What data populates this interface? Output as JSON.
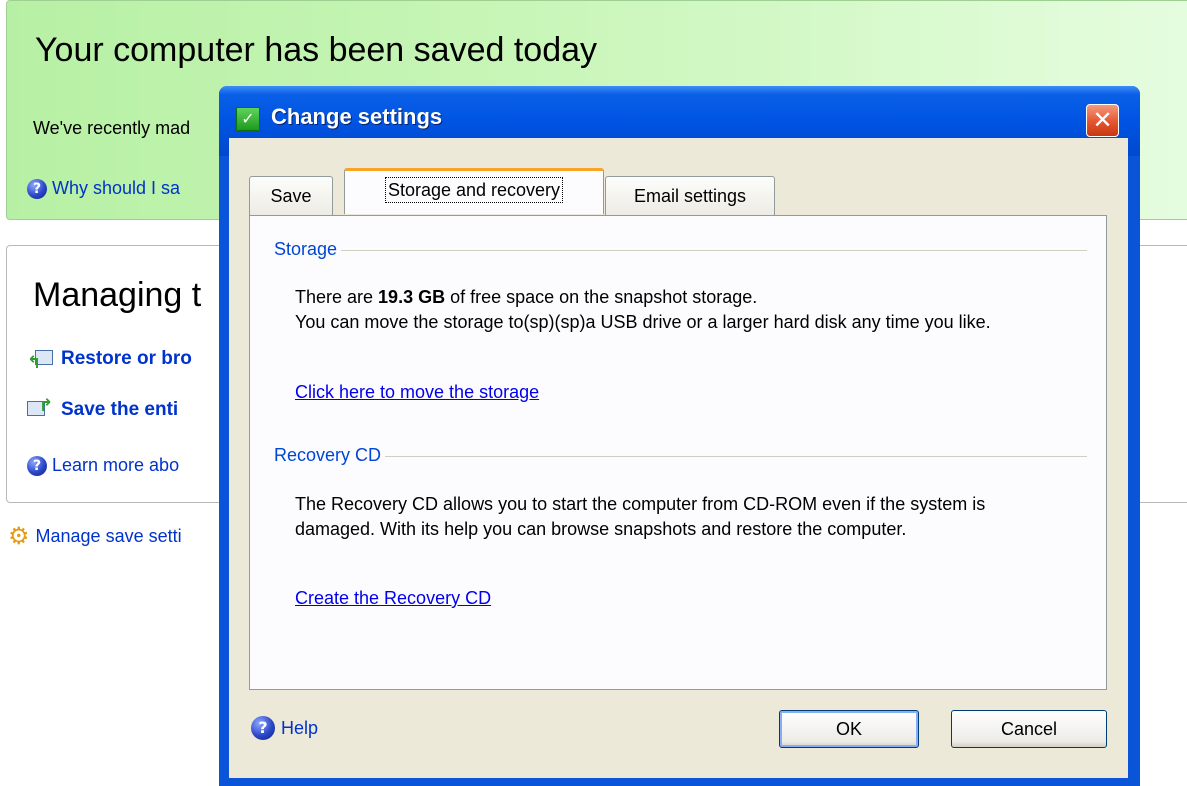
{
  "background": {
    "status_title": "Your computer has been saved today",
    "status_desc": "We've recently mad",
    "why_link": "Why should I sa",
    "manage_title": "Managing t",
    "restore_link": "Restore or bro",
    "save_entire_link": "Save the enti",
    "learn_more_link": "Learn more abo",
    "manage_settings_link": "Manage save setti"
  },
  "dialog": {
    "title": "Change settings",
    "close_glyph": "✕",
    "tabs": [
      {
        "label": "Save",
        "active": false
      },
      {
        "label": "Storage and recovery",
        "active": true
      },
      {
        "label": "Email settings",
        "active": false
      }
    ],
    "storage": {
      "heading": "Storage",
      "line1_prefix": "There are ",
      "free_space": "19.3 GB",
      "line1_suffix": " of free space on the snapshot storage.",
      "line2": "You can move the storage to(sp)(sp)a USB drive or a larger hard disk any time you like.",
      "link": "Click here to move the storage"
    },
    "recovery": {
      "heading": "Recovery CD",
      "text": "The Recovery CD allows you to start the computer from CD-ROM even if the system is damaged. With its help you can browse snapshots and restore the computer.",
      "link": "Create the Recovery CD"
    },
    "help_label": "Help",
    "ok_label": "OK",
    "cancel_label": "Cancel"
  },
  "colors": {
    "titlebar": "#0054e3",
    "link": "#0000ee",
    "group_heading": "#0046d5",
    "active_tab_accent": "#f7a428",
    "status_panel": "#c9f6b9"
  }
}
